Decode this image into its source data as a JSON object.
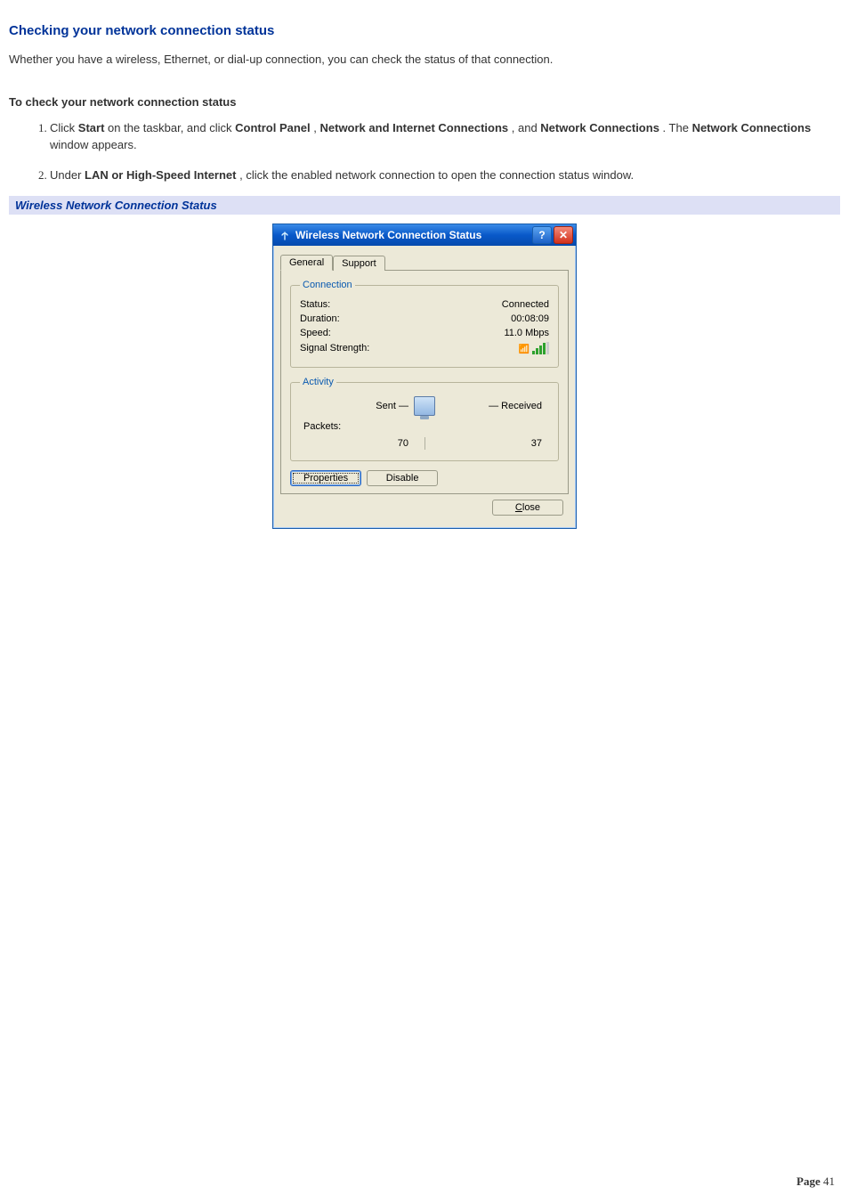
{
  "doc": {
    "heading": "Checking your network connection status",
    "intro": "Whether you have a wireless, Ethernet, or dial-up connection, you can check the status of that connection.",
    "subhead": "To check your network connection status",
    "steps": [
      {
        "prefix": "Click ",
        "b1": "Start",
        "t1": " on the taskbar, and click ",
        "b2": "Control Panel",
        "t2": ", ",
        "b3": "Network and Internet Connections",
        "t3": ", and ",
        "b4": "Network Connections",
        "t4": ". The ",
        "b5": "Network Connections",
        "t5": " window appears."
      },
      {
        "prefix": "Under ",
        "b1": "LAN or High-Speed Internet",
        "t1": ", click the enabled network connection to open the connection status window."
      }
    ],
    "figure_caption": "Wireless Network Connection Status"
  },
  "dialog": {
    "title": "Wireless Network Connection Status",
    "tabs": {
      "general": "General",
      "support": "Support"
    },
    "groups": {
      "connection": {
        "legend": "Connection",
        "status_label": "Status:",
        "status_value": "Connected",
        "duration_label": "Duration:",
        "duration_value": "00:08:09",
        "speed_label": "Speed:",
        "speed_value": "11.0 Mbps",
        "signal_label": "Signal Strength:"
      },
      "activity": {
        "legend": "Activity",
        "sent_label": "Sent",
        "received_label": "Received",
        "packets_label": "Packets:",
        "packets_sent": "70",
        "packets_received": "37"
      }
    },
    "buttons": {
      "properties": "Properties",
      "disable": "Disable",
      "close": "Close"
    }
  },
  "footer": {
    "label": "Page",
    "number": "41"
  }
}
